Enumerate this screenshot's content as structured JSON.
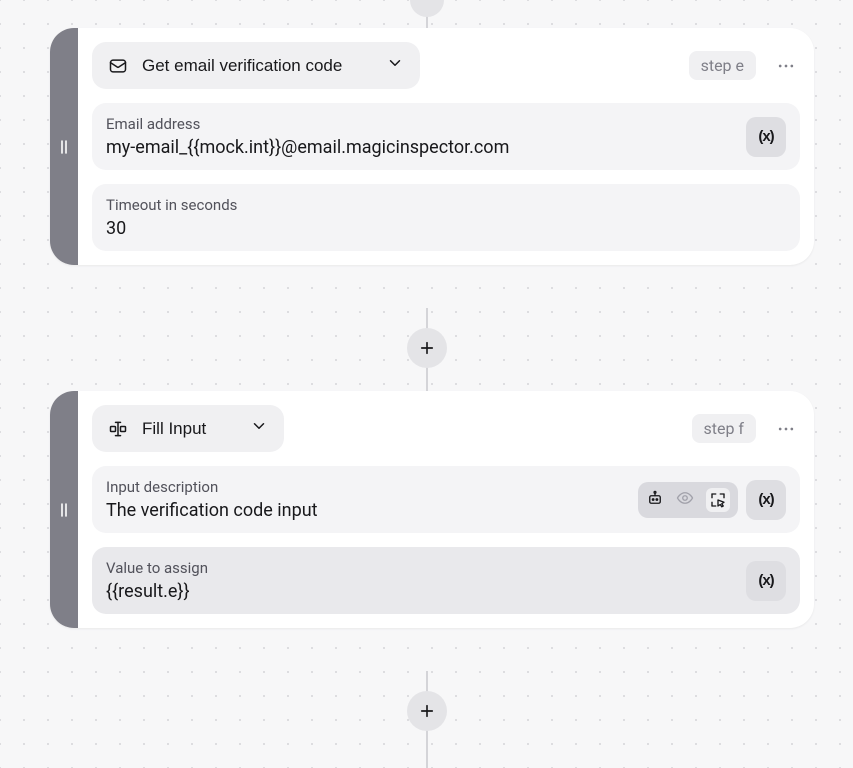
{
  "steps": [
    {
      "type_label": "Get email verification code",
      "badge": "step e",
      "fields": [
        {
          "label": "Email address",
          "value": "my-email_{{mock.int}}@email.magicinspector.com",
          "has_var": true,
          "active": false,
          "has_ai": false
        },
        {
          "label": "Timeout in seconds",
          "value": "30",
          "has_var": false,
          "active": false,
          "has_ai": false
        }
      ]
    },
    {
      "type_label": "Fill Input",
      "badge": "step f",
      "fields": [
        {
          "label": "Input description",
          "value": "The verification code input",
          "has_var": true,
          "active": false,
          "has_ai": true
        },
        {
          "label": "Value to assign",
          "value": "{{result.e}}",
          "has_var": true,
          "active": true,
          "has_ai": false
        }
      ]
    }
  ],
  "var_button": "(x)"
}
